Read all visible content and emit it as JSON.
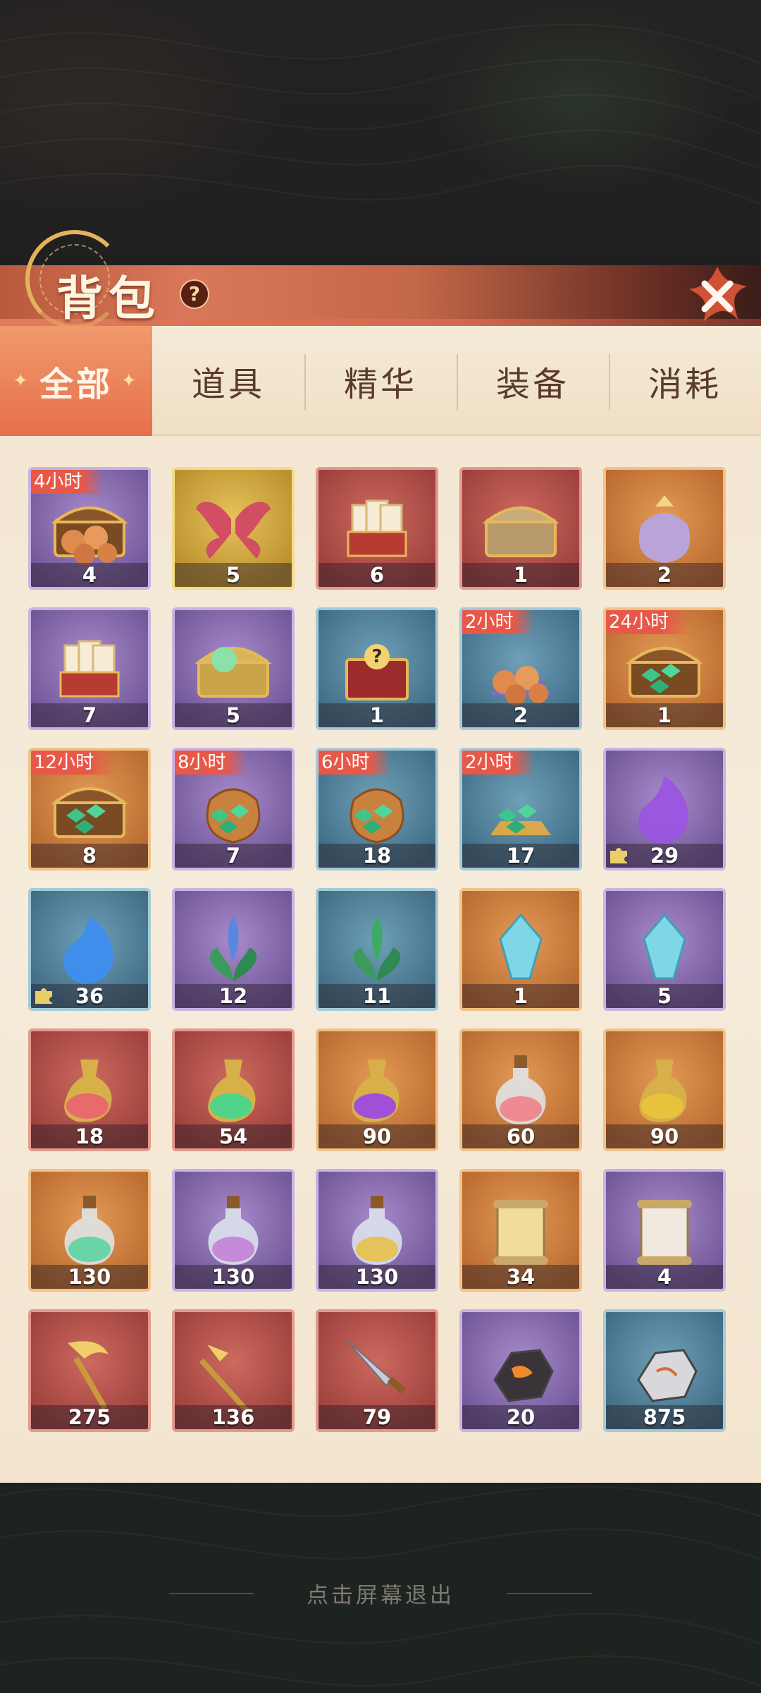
{
  "header": {
    "title": "背包",
    "help_label": "?"
  },
  "tabs": [
    {
      "label": "全部",
      "active": true
    },
    {
      "label": "道具",
      "active": false
    },
    {
      "label": "精华",
      "active": false
    },
    {
      "label": "装备",
      "active": false
    },
    {
      "label": "消耗",
      "active": false
    }
  ],
  "colors": {
    "purple": "#8e6fb7",
    "gold": "#d8b044",
    "red": "#b9544d",
    "orange": "#d28a4c",
    "blue": "#5f8ea6",
    "badge": "#e85848"
  },
  "items": [
    {
      "name": "orb-chest",
      "count": "4",
      "rarity": "purple",
      "timer": "4小时",
      "icon": "chest-orbs-icon"
    },
    {
      "name": "wings",
      "count": "5",
      "rarity": "gold",
      "timer": "",
      "icon": "wings-icon"
    },
    {
      "name": "card-box-red",
      "count": "6",
      "rarity": "red",
      "timer": "",
      "icon": "card-box-icon"
    },
    {
      "name": "treasure-chest-red",
      "count": "1",
      "rarity": "red",
      "timer": "",
      "icon": "treasure-chest-icon"
    },
    {
      "name": "gift-bag",
      "count": "2",
      "rarity": "orange",
      "timer": "",
      "icon": "gift-bag-icon"
    },
    {
      "name": "card-box-purple",
      "count": "7",
      "rarity": "purple",
      "timer": "",
      "icon": "card-box-icon"
    },
    {
      "name": "spirit-orb-chest",
      "count": "5",
      "rarity": "purple",
      "timer": "",
      "icon": "orb-chest-icon"
    },
    {
      "name": "mystery-chest",
      "count": "1",
      "rarity": "blue",
      "timer": "",
      "icon": "mystery-chest-icon"
    },
    {
      "name": "orb-cushion",
      "count": "2",
      "rarity": "blue",
      "timer": "2小时",
      "icon": "orbs-icon"
    },
    {
      "name": "jade-chest-large",
      "count": "1",
      "rarity": "orange",
      "timer": "24小时",
      "icon": "jade-chest-icon"
    },
    {
      "name": "jade-chest",
      "count": "8",
      "rarity": "orange",
      "timer": "12小时",
      "icon": "jade-chest-icon"
    },
    {
      "name": "jade-sacks",
      "count": "7",
      "rarity": "purple",
      "timer": "8小时",
      "icon": "jade-sack-icon"
    },
    {
      "name": "jade-sack",
      "count": "18",
      "rarity": "blue",
      "timer": "6小时",
      "icon": "jade-sack-icon"
    },
    {
      "name": "jade-pile",
      "count": "17",
      "rarity": "blue",
      "timer": "2小时",
      "icon": "jade-pile-icon"
    },
    {
      "name": "purple-flame",
      "count": "29",
      "rarity": "purple",
      "timer": "",
      "icon": "spirit-flame-icon",
      "fragment": true
    },
    {
      "name": "blue-flame",
      "count": "36",
      "rarity": "blue",
      "timer": "",
      "icon": "spirit-flame-icon",
      "fragment": true
    },
    {
      "name": "blue-herb",
      "count": "12",
      "rarity": "purple",
      "timer": "",
      "icon": "herb-icon"
    },
    {
      "name": "green-herb",
      "count": "11",
      "rarity": "blue",
      "timer": "",
      "icon": "herb-icon"
    },
    {
      "name": "crystal-orange",
      "count": "1",
      "rarity": "orange",
      "timer": "",
      "icon": "crystal-icon"
    },
    {
      "name": "crystal-purple",
      "count": "5",
      "rarity": "purple",
      "timer": "",
      "icon": "crystal-icon"
    },
    {
      "name": "elixir-red",
      "count": "18",
      "rarity": "red",
      "timer": "",
      "icon": "elixir-red-icon"
    },
    {
      "name": "elixir-green",
      "count": "54",
      "rarity": "red",
      "timer": "",
      "icon": "elixir-green-icon"
    },
    {
      "name": "elixir-purple",
      "count": "90",
      "rarity": "orange",
      "timer": "",
      "icon": "elixir-purple-icon"
    },
    {
      "name": "potion-pink",
      "count": "60",
      "rarity": "orange",
      "timer": "",
      "icon": "potion-pink-icon"
    },
    {
      "name": "elixir-yellow",
      "count": "90",
      "rarity": "orange",
      "timer": "",
      "icon": "elixir-yellow-icon"
    },
    {
      "name": "potion-green",
      "count": "130",
      "rarity": "orange",
      "timer": "",
      "icon": "potion-green-icon"
    },
    {
      "name": "potion-purple",
      "count": "130",
      "rarity": "purple",
      "timer": "",
      "icon": "potion-purple-icon"
    },
    {
      "name": "potion-yellow",
      "count": "130",
      "rarity": "purple",
      "timer": "",
      "icon": "potion-yellow-icon"
    },
    {
      "name": "scroll-gold",
      "count": "34",
      "rarity": "orange",
      "timer": "",
      "icon": "scroll-icon"
    },
    {
      "name": "scroll-white",
      "count": "4",
      "rarity": "purple",
      "timer": "",
      "icon": "scroll-icon"
    },
    {
      "name": "golden-staff",
      "count": "275",
      "rarity": "red",
      "timer": "",
      "icon": "staff-icon"
    },
    {
      "name": "golden-spear",
      "count": "136",
      "rarity": "red",
      "timer": "",
      "icon": "spear-icon"
    },
    {
      "name": "dagger",
      "count": "79",
      "rarity": "red",
      "timer": "",
      "icon": "dagger-icon"
    },
    {
      "name": "lava-ore",
      "count": "20",
      "rarity": "purple",
      "timer": "",
      "icon": "ore-lava-icon"
    },
    {
      "name": "silver-ore",
      "count": "875",
      "rarity": "blue",
      "timer": "",
      "icon": "ore-silver-icon"
    }
  ],
  "footer": {
    "hint": "点击屏幕退出"
  }
}
